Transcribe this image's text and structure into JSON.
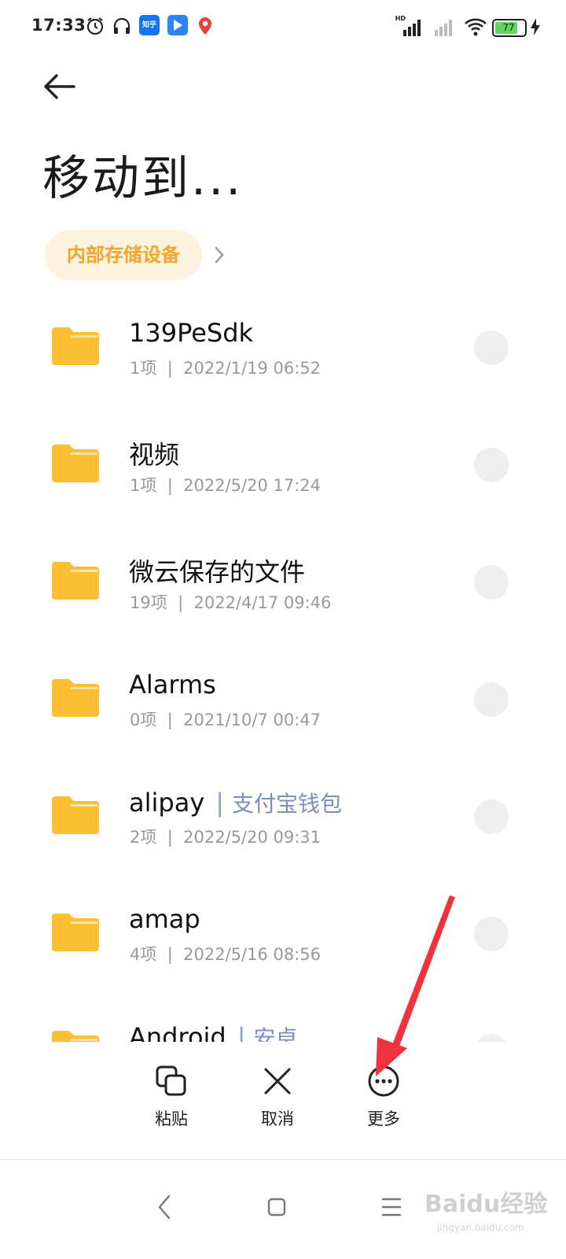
{
  "status_bar": {
    "time": "17:33",
    "app_icons": [
      "alarm-icon",
      "headphones-icon",
      "zhihu-icon",
      "blue-app-icon",
      "location-app-icon"
    ],
    "zhihu_label": "知乎",
    "signal_label": "HD",
    "battery": "77"
  },
  "header": {
    "title": "移动到...",
    "breadcrumb": "内部存储设备"
  },
  "files": [
    {
      "name": "139PeSdk",
      "tag": "",
      "count": "1项",
      "date": "2022/1/19 06:52"
    },
    {
      "name": "视频",
      "tag": "",
      "count": "1项",
      "date": "2022/5/20 17:24"
    },
    {
      "name": "微云保存的文件",
      "tag": "",
      "count": "19项",
      "date": "2022/4/17 09:46"
    },
    {
      "name": "Alarms",
      "tag": "",
      "count": "0项",
      "date": "2021/10/7 00:47"
    },
    {
      "name": "alipay",
      "tag": "支付宝钱包",
      "count": "2项",
      "date": "2022/5/20 09:31"
    },
    {
      "name": "amap",
      "tag": "",
      "count": "4项",
      "date": "2022/5/16 08:56"
    },
    {
      "name": "Android",
      "tag": "安卓",
      "count": "",
      "date": ""
    }
  ],
  "actions": {
    "paste": "粘贴",
    "cancel": "取消",
    "more": "更多"
  },
  "colors": {
    "folder": "#fbbf33",
    "breadcrumb_bg": "#fdf2dd",
    "breadcrumb_text": "#f1a62a",
    "annotation_arrow": "#f0323c"
  },
  "watermark": {
    "brand": "Baidu经验",
    "url": "jingyan.baidu.com"
  }
}
